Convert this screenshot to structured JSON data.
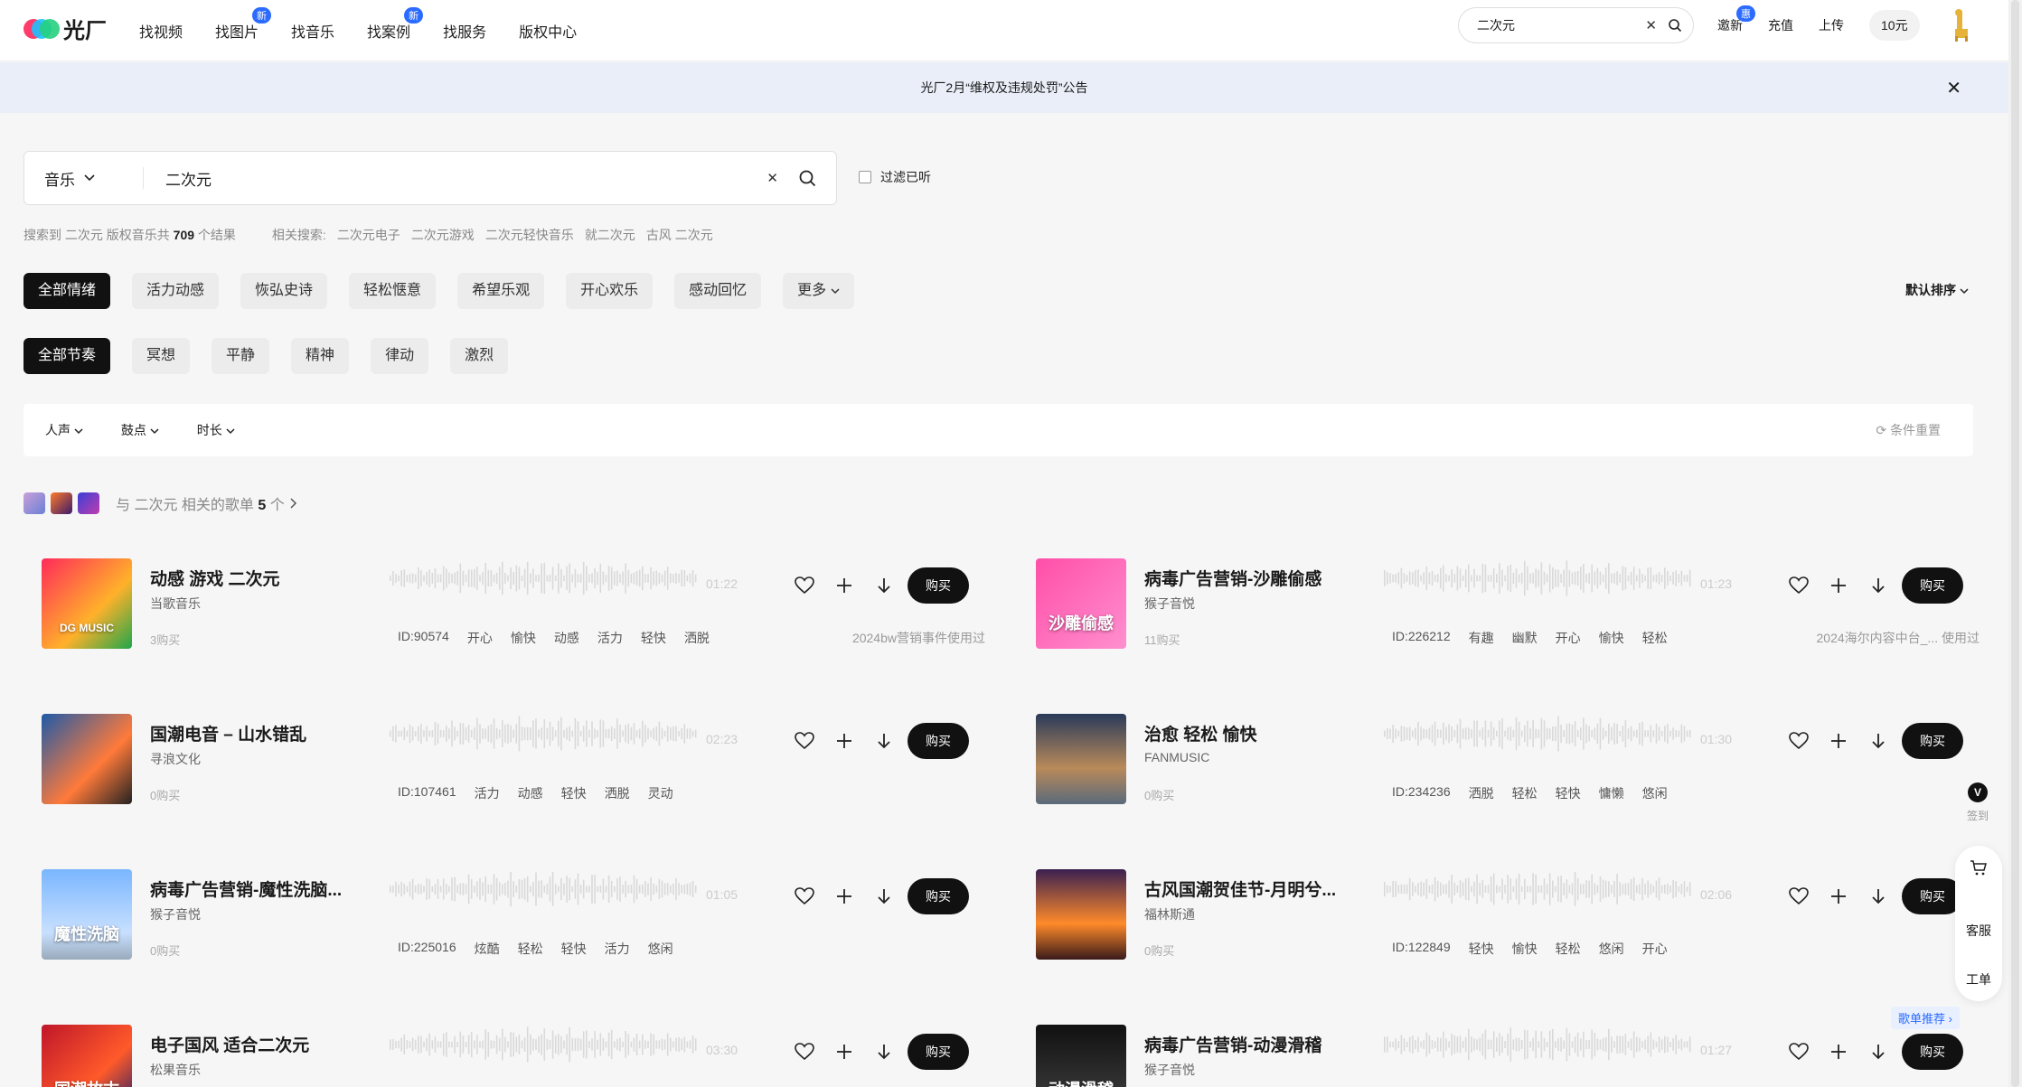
{
  "header": {
    "logo_text": "光厂",
    "nav": [
      {
        "label": "找视频",
        "badge": ""
      },
      {
        "label": "找图片",
        "badge": "新"
      },
      {
        "label": "找音乐",
        "badge": ""
      },
      {
        "label": "找案例",
        "badge": "新"
      },
      {
        "label": "找服务",
        "badge": ""
      },
      {
        "label": "版权中心",
        "badge": ""
      }
    ],
    "search_value": "二次元",
    "links": {
      "invite": "邀新",
      "invite_badge": "惠",
      "recharge": "充值",
      "upload": "上传",
      "balance": "10元"
    }
  },
  "notice": {
    "text": "光厂2月“维权及违规处罚”公告"
  },
  "search": {
    "category": "音乐",
    "value": "二次元",
    "filter_heard": "过滤已听"
  },
  "summary": {
    "prefix": "搜索到 二次元 版权音乐共",
    "count": "709",
    "suffix": "个结果",
    "related_label": "相关搜索:",
    "related": [
      "二次元电子",
      "二次元游戏",
      "二次元轻快音乐",
      "就二次元",
      "古风 二次元"
    ]
  },
  "mood_chips": [
    "全部情绪",
    "活力动感",
    "恢弘史诗",
    "轻松惬意",
    "希望乐观",
    "开心欢乐",
    "感动回忆",
    "更多"
  ],
  "rhythm_chips": [
    "全部节奏",
    "冥想",
    "平静",
    "精神",
    "律动",
    "激烈"
  ],
  "sort_label": "默认排序",
  "conditions": {
    "vocal": "人声",
    "beat": "鼓点",
    "duration": "时长",
    "reset": "条件重置"
  },
  "playlist": {
    "prefix": "与 二次元 相关的歌单",
    "count": "5",
    "unit": "个"
  },
  "tracks": [
    {
      "title": "动感 游戏 二次元",
      "artist": "当歌音乐",
      "buys": "3购买",
      "duration": "01:22",
      "tags": [
        "ID:90574",
        "开心",
        "愉快",
        "动感",
        "活力",
        "轻快",
        "洒脱"
      ],
      "usage": "2024bw营销事件使用过",
      "buy": "购买",
      "cover_text": "DG MUSIC"
    },
    {
      "title": "病毒广告营销-沙雕偷感",
      "artist": "猴子音悦",
      "buys": "11购买",
      "duration": "01:23",
      "tags": [
        "ID:226212",
        "有趣",
        "幽默",
        "开心",
        "愉快",
        "轻松"
      ],
      "usage": "2024海尔内容中台_... 使用过",
      "buy": "购买",
      "cover_text": "沙雕偷感"
    },
    {
      "title": "国潮电音 – 山水错乱",
      "artist": "寻浪文化",
      "buys": "0购买",
      "duration": "02:23",
      "tags": [
        "ID:107461",
        "活力",
        "动感",
        "轻快",
        "洒脱",
        "灵动"
      ],
      "usage": "",
      "buy": "购买",
      "cover_text": ""
    },
    {
      "title": "治愈 轻松 愉快",
      "artist": "FANMUSIC",
      "buys": "0购买",
      "duration": "01:30",
      "tags": [
        "ID:234236",
        "洒脱",
        "轻松",
        "轻快",
        "慵懒",
        "悠闲"
      ],
      "usage": "",
      "buy": "购买",
      "cover_text": ""
    },
    {
      "title": "病毒广告营销-魔性洗脑...",
      "artist": "猴子音悦",
      "buys": "0购买",
      "duration": "01:05",
      "tags": [
        "ID:225016",
        "炫酷",
        "轻松",
        "轻快",
        "活力",
        "悠闲"
      ],
      "usage": "",
      "buy": "购买",
      "cover_text": "魔性洗脑"
    },
    {
      "title": "古风国潮贺佳节-月明兮...",
      "artist": "福林斯通",
      "buys": "0购买",
      "duration": "02:06",
      "tags": [
        "ID:122849",
        "轻快",
        "愉快",
        "轻松",
        "悠闲",
        "开心"
      ],
      "usage": "",
      "buy": "购买",
      "cover_text": ""
    },
    {
      "title": "电子国风 适合二次元",
      "artist": "松果音乐",
      "buys": "",
      "duration": "03:30",
      "tags": [],
      "usage": "",
      "buy": "购买",
      "cover_text": "国潮故古"
    },
    {
      "title": "病毒广告营销-动漫滑稽",
      "artist": "猴子音悦",
      "buys": "",
      "duration": "01:27",
      "tags": [],
      "usage": "",
      "buy": "购买",
      "cover_text": "动漫滑稽"
    }
  ],
  "side": {
    "sign": "签到",
    "service": "客服",
    "ticket": "工单",
    "recommend": "歌单推荐 ›"
  },
  "colors": {
    "accent": "#2b6bff",
    "dark": "#111111",
    "notice_bg": "#e9eef8"
  }
}
